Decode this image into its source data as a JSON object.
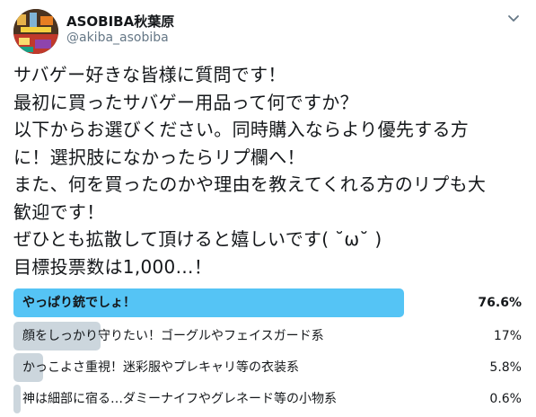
{
  "user": {
    "display_name": "ASOBIBA秋葉原",
    "handle": "@akiba_asobiba"
  },
  "tweet": {
    "lines": [
      "サバゲー好きな皆様に質問です！",
      "最初に買ったサバゲー用品って何ですか？",
      "以下からお選びください。同時購入ならより優先する方",
      "に！選択肢になかったらリプ欄へ！",
      "また、何を買ったのかや理由を教えてくれる方のリプも大",
      "歓迎です！",
      "ぜひとも拡散して頂けると嬉しいです( ˘ω˘ )",
      "目標投票数は1,000…！"
    ]
  },
  "poll": {
    "options": [
      {
        "label": "やっぱり銃でしょ！",
        "percent_text": "76.6%",
        "value": 76.6,
        "winner": true
      },
      {
        "label": "顔をしっかり守りたい！ゴーグルやフェイスガード系",
        "percent_text": "17%",
        "value": 17,
        "winner": false
      },
      {
        "label": "かっこよさ重視！迷彩服やプレキャリ等の衣装系",
        "percent_text": "5.8%",
        "value": 5.8,
        "winner": false
      },
      {
        "label": "神は細部に宿る…ダミーナイフやグレネード等の小物系",
        "percent_text": "0.6%",
        "value": 0.6,
        "winner": false
      }
    ]
  },
  "colors": {
    "winner_bar": "#55c4f5",
    "other_bar": "#ccd6dd",
    "handle_text": "#657786",
    "caret": "#657786"
  },
  "icons": {
    "caret": "chevron-down-icon",
    "avatar": "avatar"
  }
}
